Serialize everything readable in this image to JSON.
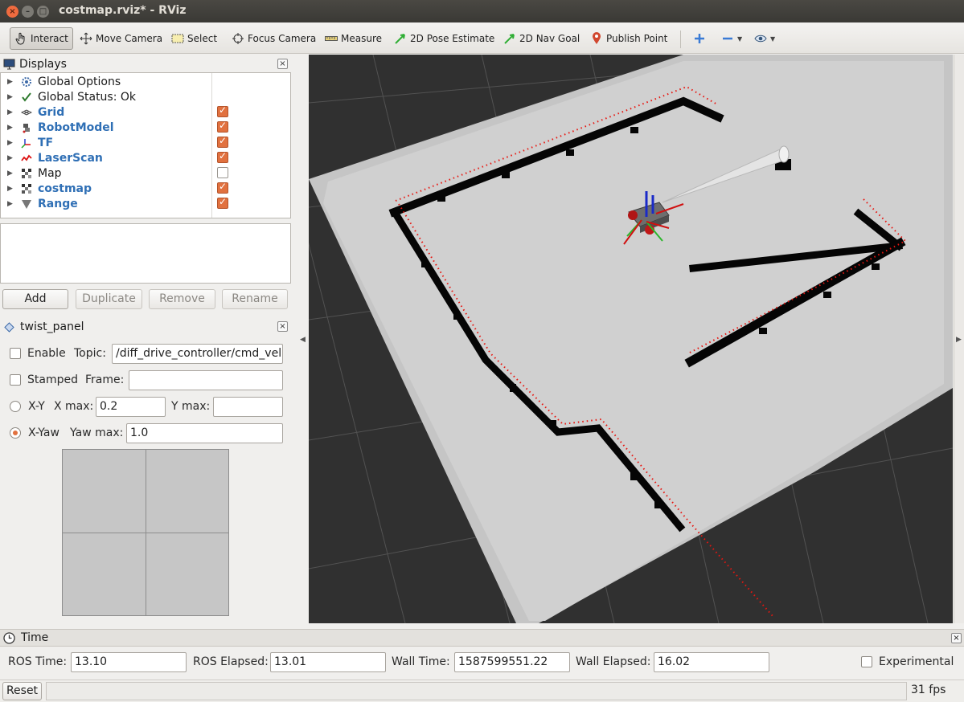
{
  "window": {
    "title": "costmap.rviz* - RViz"
  },
  "toolbar": {
    "interact": "Interact",
    "move_camera": "Move Camera",
    "select": "Select",
    "focus_camera": "Focus Camera",
    "measure": "Measure",
    "pose_estimate": "2D Pose Estimate",
    "nav_goal": "2D Nav Goal",
    "publish_point": "Publish Point"
  },
  "displays": {
    "title": "Displays",
    "items": [
      {
        "label": "Global Options",
        "icon": "gear-icon",
        "style": "normal",
        "checked": null
      },
      {
        "label": "Global Status: Ok",
        "icon": "check-icon",
        "style": "normal",
        "checked": null
      },
      {
        "label": "Grid",
        "icon": "grid-icon",
        "style": "blue",
        "checked": true
      },
      {
        "label": "RobotModel",
        "icon": "robot-icon",
        "style": "blue",
        "checked": true
      },
      {
        "label": "TF",
        "icon": "axes-icon",
        "style": "blue",
        "checked": true
      },
      {
        "label": "LaserScan",
        "icon": "laser-icon",
        "style": "blue",
        "checked": true
      },
      {
        "label": "Map",
        "icon": "map-icon",
        "style": "normal",
        "checked": false
      },
      {
        "label": "costmap",
        "icon": "map-icon",
        "style": "blue",
        "checked": true
      },
      {
        "label": "Range",
        "icon": "cone-icon",
        "style": "blue",
        "checked": true
      }
    ],
    "buttons": {
      "add": "Add",
      "duplicate": "Duplicate",
      "remove": "Remove",
      "rename": "Rename"
    }
  },
  "twist_panel": {
    "title": "twist_panel",
    "enable_label": "Enable",
    "topic_label": "Topic:",
    "topic_value": "/diff_drive_controller/cmd_vel",
    "stamped_label": "Stamped",
    "frame_label": "Frame:",
    "frame_value": "",
    "xy_label": "X-Y",
    "xmax_label": "X max:",
    "xmax_value": "0.2",
    "ymax_label": "Y max:",
    "ymax_value": "",
    "xyaw_label": "X-Yaw",
    "yawmax_label": "Yaw max:",
    "yawmax_value": "1.0",
    "mode": "X-Yaw"
  },
  "time": {
    "title": "Time",
    "ros_time_label": "ROS Time:",
    "ros_time": "13.10",
    "ros_elapsed_label": "ROS Elapsed:",
    "ros_elapsed": "13.01",
    "wall_time_label": "Wall Time:",
    "wall_time": "1587599551.22",
    "wall_elapsed_label": "Wall Elapsed:",
    "wall_elapsed": "16.02",
    "experimental_label": "Experimental"
  },
  "status": {
    "reset": "Reset",
    "fps": "31 fps"
  },
  "colors": {
    "accent": "#e1713f",
    "viewport_bg": "#303030",
    "laser": "#e8150f",
    "display_blue": "#2f6fb5"
  }
}
